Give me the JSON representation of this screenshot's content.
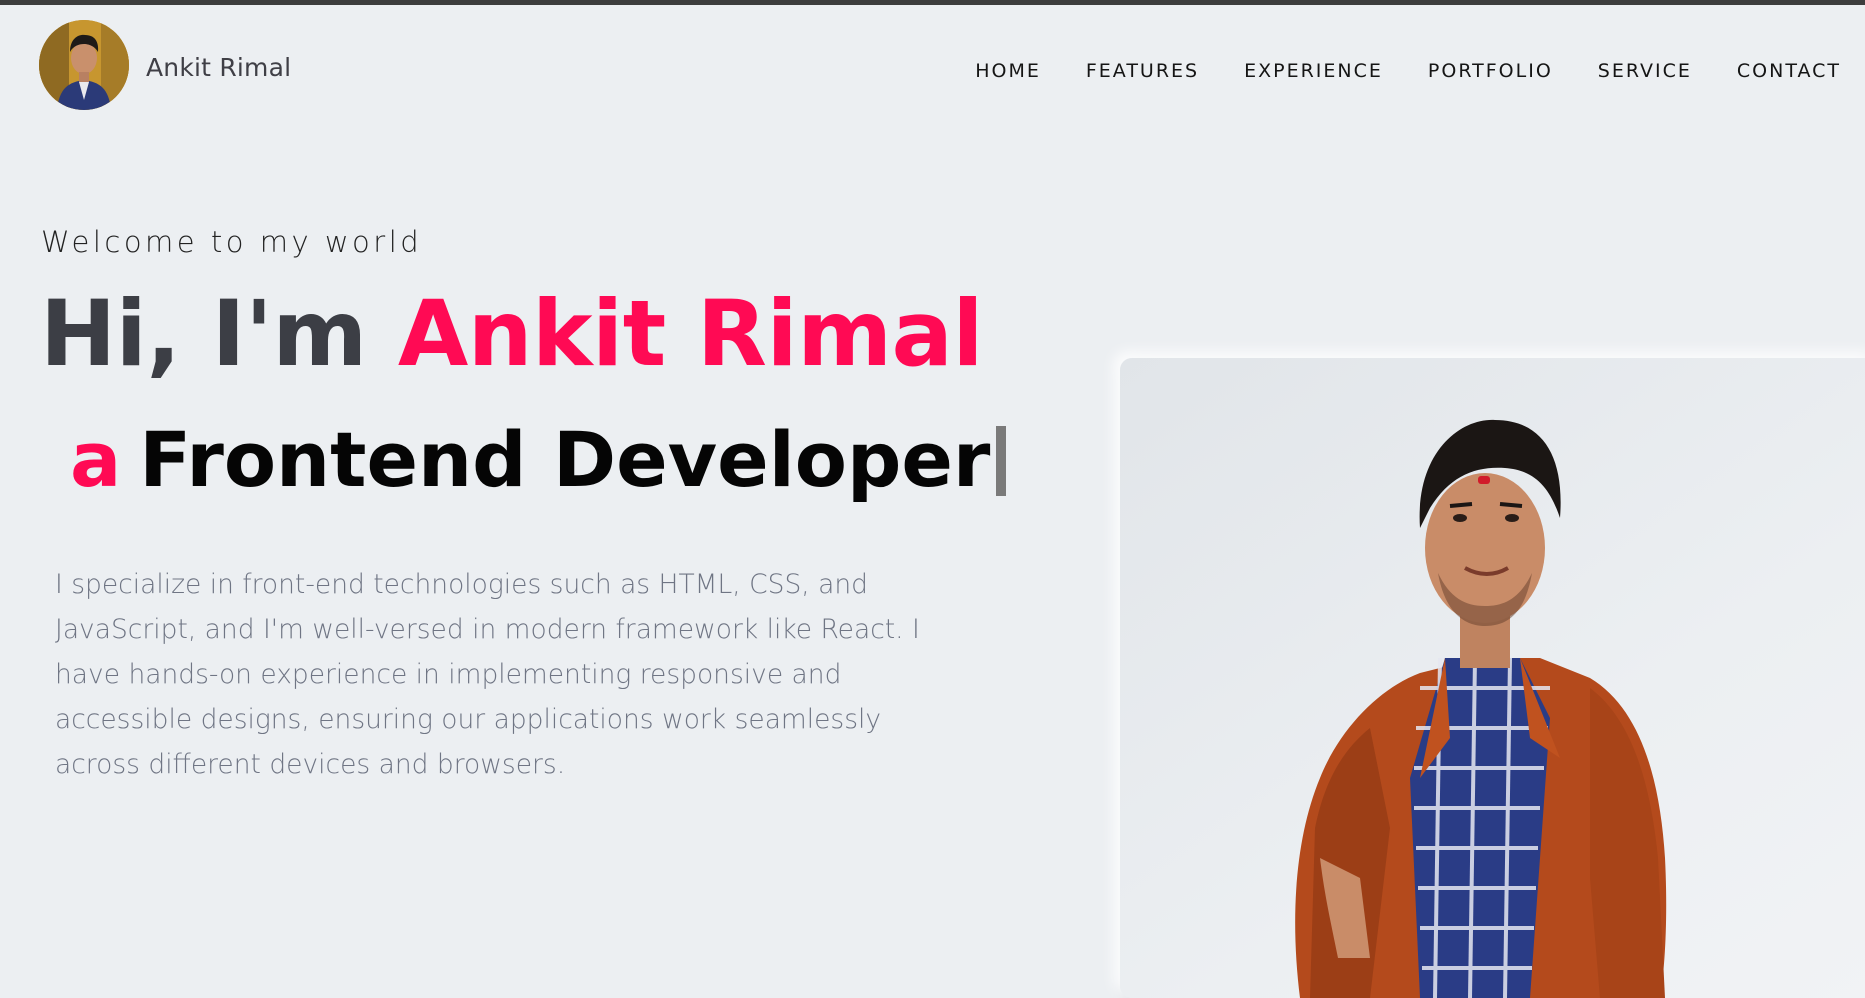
{
  "brand": {
    "name": "Ankit Rimal",
    "avatar_icon": "profile-photo"
  },
  "nav": {
    "items": [
      {
        "label": "HOME"
      },
      {
        "label": "FEATURES"
      },
      {
        "label": "EXPERIENCE"
      },
      {
        "label": "PORTFOLIO"
      },
      {
        "label": "SERVICE"
      },
      {
        "label": "CONTACT"
      }
    ]
  },
  "hero": {
    "welcome": "Welcome to my world",
    "greeting": "Hi, I'm ",
    "name": "Ankit Rimal",
    "role_article": "a",
    "role": "Frontend Developer",
    "bio": "I specialize in front-end technologies such as HTML, CSS, and JavaScript, and I'm well-versed in modern framework like React. I have hands-on experience in implementing responsive and accessible designs, ensuring our applications work seamlessly across different devices and browsers."
  },
  "colors": {
    "accent": "#ff0a54",
    "background": "#eceff2",
    "heading": "#3c3e45",
    "body_text": "#6f7584"
  }
}
